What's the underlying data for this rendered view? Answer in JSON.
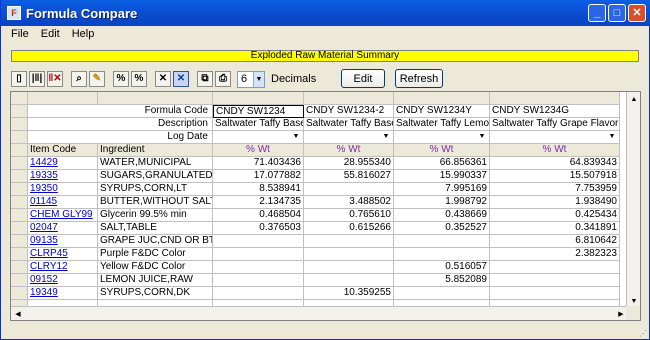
{
  "window": {
    "title": "Formula Compare",
    "icon": "formula-app-icon"
  },
  "menu": [
    "File",
    "Edit",
    "Help"
  ],
  "banner": "Exploded Raw Material Summary",
  "toolbar": {
    "icons": [
      "new-page-icon",
      "columns-icon",
      "delete-columns-icon",
      "search-icon",
      "pencil-icon",
      "percent-icon",
      "percent-toggle-icon",
      "collapse-icon",
      "expand-icon",
      "copy-icon",
      "print-icon"
    ],
    "decimals_value": "6",
    "decimals_label": "Decimals",
    "edit_label": "Edit",
    "refresh_label": "Refresh"
  },
  "grid": {
    "header_labels": {
      "formula_code": "Formula Code",
      "description": "Description",
      "log_date": "Log Date"
    },
    "columns": [
      {
        "code": "CNDY SW1234",
        "description": "Saltwater Taffy Base",
        "unit": "% Wt"
      },
      {
        "code": "CNDY SW1234-2",
        "description": "Saltwater Taffy Base",
        "unit": "% Wt"
      },
      {
        "code": "CNDY SW1234Y",
        "description": "Saltwater Taffy Lemon I",
        "unit": "% Wt"
      },
      {
        "code": "CNDY SW1234G",
        "description": "Saltwater Taffy Grape Flavor",
        "unit": "% Wt"
      }
    ],
    "col_headers": {
      "item_code": "Item Code",
      "ingredient": "Ingredient"
    },
    "rows": [
      {
        "item": "14429",
        "ingredient": "WATER,MUNICIPAL",
        "v": [
          "71.403436",
          "28.955340",
          "66.856361",
          "64.839343"
        ]
      },
      {
        "item": "19335",
        "ingredient": "SUGARS,GRANULATED",
        "v": [
          "17.077882",
          "55.816027",
          "15.990337",
          "15.507918"
        ]
      },
      {
        "item": "19350",
        "ingredient": "SYRUPS,CORN,LT",
        "v": [
          "8.538941",
          "",
          "7.995169",
          "7.753959"
        ]
      },
      {
        "item": "01145",
        "ingredient": "BUTTER,WITHOUT SALT",
        "v": [
          "2.134735",
          "3.488502",
          "1.998792",
          "1.938490"
        ]
      },
      {
        "item": "CHEM GLY99",
        "ingredient": "Glycerin 99.5% min",
        "v": [
          "0.468504",
          "0.765610",
          "0.438669",
          "0.425434"
        ]
      },
      {
        "item": "02047",
        "ingredient": "SALT,TABLE",
        "v": [
          "0.376503",
          "0.615266",
          "0.352527",
          "0.341891"
        ]
      },
      {
        "item": "09135",
        "ingredient": "GRAPE JUC,CND OR BTLD",
        "v": [
          "",
          "",
          "",
          "6.810642"
        ]
      },
      {
        "item": "CLRP45",
        "ingredient": "Purple F&DC Color",
        "v": [
          "",
          "",
          "",
          "2.382323"
        ]
      },
      {
        "item": "CLRY12",
        "ingredient": "Yellow F&DC Color",
        "v": [
          "",
          "",
          "0.516057",
          ""
        ]
      },
      {
        "item": "09152",
        "ingredient": "LEMON JUICE,RAW",
        "v": [
          "",
          "",
          "5.852089",
          ""
        ]
      },
      {
        "item": "19349",
        "ingredient": "SYRUPS,CORN,DK",
        "v": [
          "",
          "10.359255",
          "",
          ""
        ]
      }
    ]
  },
  "colors": {
    "link": "#0000cc",
    "unit": "#7a2fa3",
    "banner": "#ffff00",
    "titlebar": "#0b4fd2"
  }
}
